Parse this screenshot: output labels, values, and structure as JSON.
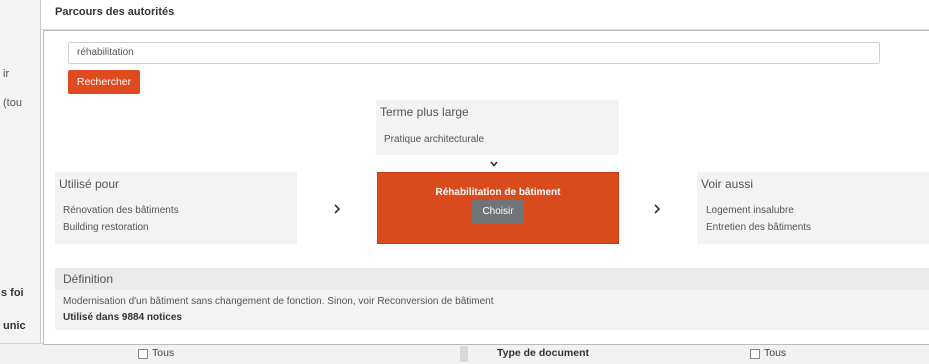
{
  "background": {
    "left_fragments": [
      "ir",
      "(tou",
      "s foi",
      "unic"
    ],
    "bottom": {
      "all_label_left": "Tous",
      "doc_type_label": "Type de document",
      "all_label_right": "Tous"
    }
  },
  "modal": {
    "title": "Parcours des autorités",
    "search": {
      "value": "réhabilitation",
      "button": "Rechercher"
    },
    "broader": {
      "heading": "Terme plus large",
      "items": [
        "Pratique architecturale"
      ]
    },
    "used_for": {
      "heading": "Utilisé pour",
      "items": [
        "Rénovation des bâtiments",
        "Building restoration"
      ]
    },
    "current": {
      "term": "Réhabilitation de bâtiment",
      "button": "Choisir"
    },
    "see_also": {
      "heading": "Voir aussi",
      "items": [
        "Logement insalubre",
        "Entretien des bâtiments"
      ]
    },
    "definition": {
      "heading": "Définition",
      "text": "Modernisation d'un bâtiment sans changement de fonction. Sinon, voir Reconversion de bâtiment",
      "usage": "Utilisé dans 9884 notices"
    }
  },
  "colors": {
    "accent": "#e04a1f",
    "current_bg": "#d94a1d",
    "choose_btn": "#6f7478",
    "panel_bg": "#f3f3f3"
  }
}
